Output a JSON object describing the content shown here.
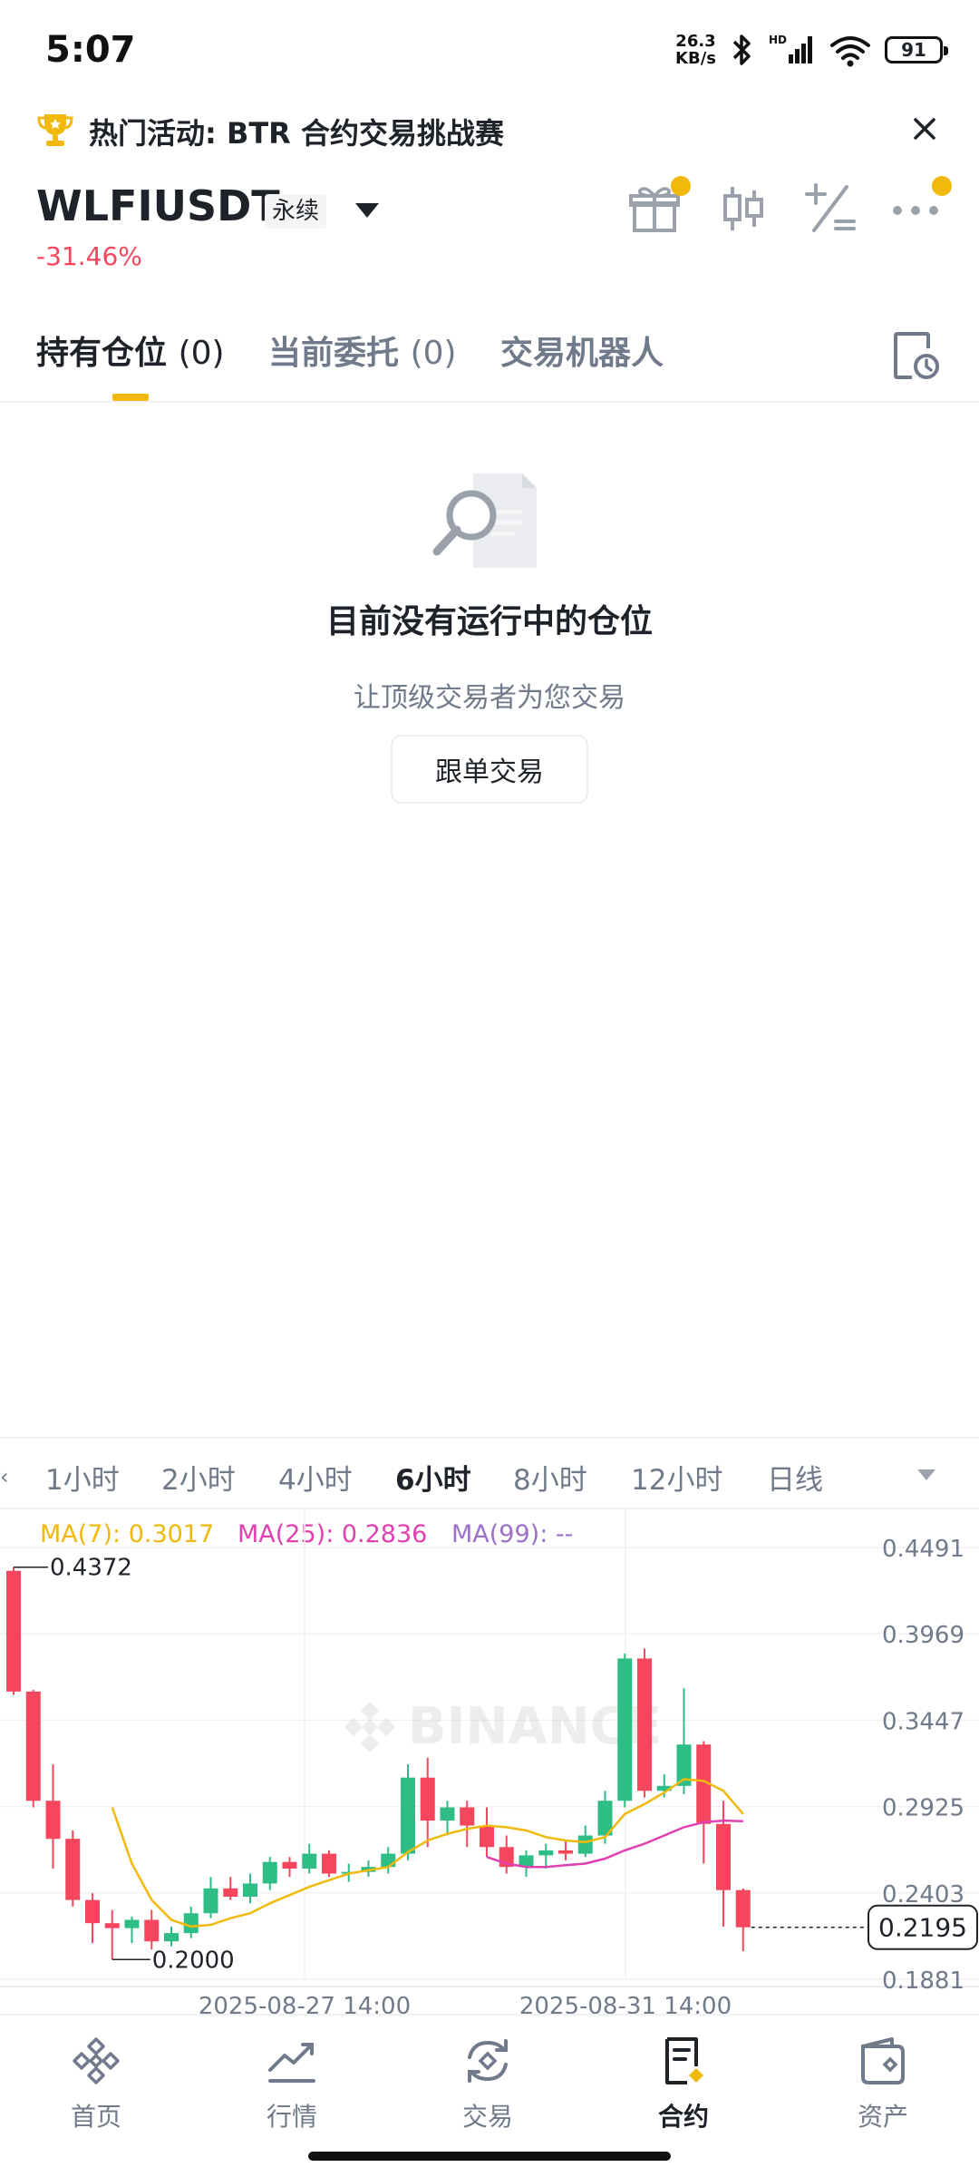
{
  "status_bar": {
    "time": "5:07",
    "net_speed_value": "26.3",
    "net_speed_unit": "KB/s",
    "battery": "91"
  },
  "promo": {
    "text": "热门活动: BTR 合约交易挑战赛"
  },
  "header": {
    "symbol": "WLFIUSDT",
    "contract_type": "永续",
    "change": "-31.46%"
  },
  "tabs": [
    {
      "label": "持有仓位",
      "count": "(0)"
    },
    {
      "label": "当前委托",
      "count": "(0)"
    },
    {
      "label": "交易机器人",
      "count": ""
    }
  ],
  "empty_state": {
    "title": "目前没有运行中的仓位",
    "subtitle": "让顶级交易者为您交易",
    "button": "跟单交易"
  },
  "intervals": [
    "1小时",
    "2小时",
    "4小时",
    "6小时",
    "8小时",
    "12小时",
    "日线"
  ],
  "selected_interval": "6小时",
  "ma": [
    {
      "label": "MA(7): 0.3017",
      "color": "#f0b90b"
    },
    {
      "label": "MA(25): 0.2836",
      "color": "#e040b0"
    },
    {
      "label": "MA(99): --",
      "color": "#9c6fc8"
    }
  ],
  "chart_data": {
    "type": "candlestick",
    "y_axis_labels": [
      "0.4491",
      "0.3969",
      "0.3447",
      "0.2925",
      "0.2403",
      "0.1881"
    ],
    "ylim": [
      0.1881,
      0.4491
    ],
    "x_axis_labels": [
      "2025-08-27 14:00",
      "2025-08-31 14:00"
    ],
    "high_marker": "0.4372",
    "low_marker": "0.2000",
    "current_price": "0.2195",
    "watermark": "BINANCE",
    "colors": {
      "up": "#2ebd85",
      "down": "#f6465d"
    },
    "candles": [
      {
        "o": 0.435,
        "h": 0.4372,
        "l": 0.36,
        "c": 0.362
      },
      {
        "o": 0.362,
        "h": 0.363,
        "l": 0.292,
        "c": 0.296
      },
      {
        "o": 0.296,
        "h": 0.318,
        "l": 0.255,
        "c": 0.273
      },
      {
        "o": 0.273,
        "h": 0.278,
        "l": 0.232,
        "c": 0.236
      },
      {
        "o": 0.236,
        "h": 0.24,
        "l": 0.21,
        "c": 0.222
      },
      {
        "o": 0.222,
        "h": 0.23,
        "l": 0.2,
        "c": 0.219
      },
      {
        "o": 0.219,
        "h": 0.226,
        "l": 0.21,
        "c": 0.224
      },
      {
        "o": 0.224,
        "h": 0.23,
        "l": 0.206,
        "c": 0.211
      },
      {
        "o": 0.211,
        "h": 0.22,
        "l": 0.208,
        "c": 0.216
      },
      {
        "o": 0.216,
        "h": 0.232,
        "l": 0.213,
        "c": 0.228
      },
      {
        "o": 0.228,
        "h": 0.25,
        "l": 0.225,
        "c": 0.243
      },
      {
        "o": 0.243,
        "h": 0.25,
        "l": 0.236,
        "c": 0.238
      },
      {
        "o": 0.238,
        "h": 0.252,
        "l": 0.234,
        "c": 0.246
      },
      {
        "o": 0.246,
        "h": 0.262,
        "l": 0.242,
        "c": 0.259
      },
      {
        "o": 0.259,
        "h": 0.262,
        "l": 0.25,
        "c": 0.255
      },
      {
        "o": 0.255,
        "h": 0.27,
        "l": 0.252,
        "c": 0.264
      },
      {
        "o": 0.264,
        "h": 0.266,
        "l": 0.25,
        "c": 0.252
      },
      {
        "o": 0.252,
        "h": 0.258,
        "l": 0.247,
        "c": 0.253
      },
      {
        "o": 0.253,
        "h": 0.26,
        "l": 0.25,
        "c": 0.256
      },
      {
        "o": 0.256,
        "h": 0.268,
        "l": 0.252,
        "c": 0.264
      },
      {
        "o": 0.264,
        "h": 0.318,
        "l": 0.26,
        "c": 0.31
      },
      {
        "o": 0.31,
        "h": 0.322,
        "l": 0.268,
        "c": 0.284
      },
      {
        "o": 0.284,
        "h": 0.296,
        "l": 0.275,
        "c": 0.292
      },
      {
        "o": 0.292,
        "h": 0.296,
        "l": 0.268,
        "c": 0.281
      },
      {
        "o": 0.281,
        "h": 0.292,
        "l": 0.262,
        "c": 0.268
      },
      {
        "o": 0.268,
        "h": 0.275,
        "l": 0.252,
        "c": 0.256
      },
      {
        "o": 0.256,
        "h": 0.266,
        "l": 0.25,
        "c": 0.263
      },
      {
        "o": 0.263,
        "h": 0.27,
        "l": 0.255,
        "c": 0.266
      },
      {
        "o": 0.266,
        "h": 0.272,
        "l": 0.26,
        "c": 0.264
      },
      {
        "o": 0.264,
        "h": 0.281,
        "l": 0.262,
        "c": 0.275
      },
      {
        "o": 0.275,
        "h": 0.302,
        "l": 0.27,
        "c": 0.296
      },
      {
        "o": 0.296,
        "h": 0.385,
        "l": 0.292,
        "c": 0.382
      },
      {
        "o": 0.382,
        "h": 0.388,
        "l": 0.298,
        "c": 0.302
      },
      {
        "o": 0.302,
        "h": 0.312,
        "l": 0.298,
        "c": 0.305
      },
      {
        "o": 0.305,
        "h": 0.364,
        "l": 0.3,
        "c": 0.33
      },
      {
        "o": 0.33,
        "h": 0.332,
        "l": 0.258,
        "c": 0.282
      },
      {
        "o": 0.282,
        "h": 0.296,
        "l": 0.22,
        "c": 0.242
      },
      {
        "o": 0.242,
        "h": 0.243,
        "l": 0.205,
        "c": 0.2195
      }
    ],
    "ma7": [
      [
        5,
        0.292
      ],
      [
        6,
        0.258
      ],
      [
        7,
        0.236
      ],
      [
        8,
        0.224
      ],
      [
        9,
        0.22
      ],
      [
        10,
        0.221
      ],
      [
        11,
        0.225
      ],
      [
        12,
        0.228
      ],
      [
        13,
        0.234
      ],
      [
        14,
        0.239
      ],
      [
        15,
        0.244
      ],
      [
        16,
        0.248
      ],
      [
        17,
        0.252
      ],
      [
        18,
        0.254
      ],
      [
        19,
        0.256
      ],
      [
        20,
        0.265
      ],
      [
        21,
        0.272
      ],
      [
        22,
        0.276
      ],
      [
        23,
        0.279
      ],
      [
        24,
        0.281
      ],
      [
        25,
        0.28
      ],
      [
        26,
        0.278
      ],
      [
        27,
        0.274
      ],
      [
        28,
        0.272
      ],
      [
        29,
        0.271
      ],
      [
        30,
        0.274
      ],
      [
        31,
        0.288
      ],
      [
        32,
        0.294
      ],
      [
        33,
        0.301
      ],
      [
        34,
        0.309
      ],
      [
        35,
        0.308
      ],
      [
        36,
        0.302
      ],
      [
        37,
        0.288
      ]
    ],
    "ma25": [
      [
        24,
        0.262
      ],
      [
        25,
        0.258
      ],
      [
        26,
        0.256
      ],
      [
        27,
        0.256
      ],
      [
        28,
        0.257
      ],
      [
        29,
        0.258
      ],
      [
        30,
        0.261
      ],
      [
        31,
        0.266
      ],
      [
        32,
        0.27
      ],
      [
        33,
        0.275
      ],
      [
        34,
        0.28
      ],
      [
        35,
        0.283
      ],
      [
        36,
        0.284
      ],
      [
        37,
        0.2836
      ]
    ]
  },
  "bottom_nav": [
    {
      "label": "首页",
      "icon": "binance-logo-icon"
    },
    {
      "label": "行情",
      "icon": "market-chart-icon"
    },
    {
      "label": "交易",
      "icon": "trade-exchange-icon"
    },
    {
      "label": "合约",
      "icon": "futures-contract-icon"
    },
    {
      "label": "资产",
      "icon": "wallet-icon"
    }
  ],
  "active_nav": 3
}
